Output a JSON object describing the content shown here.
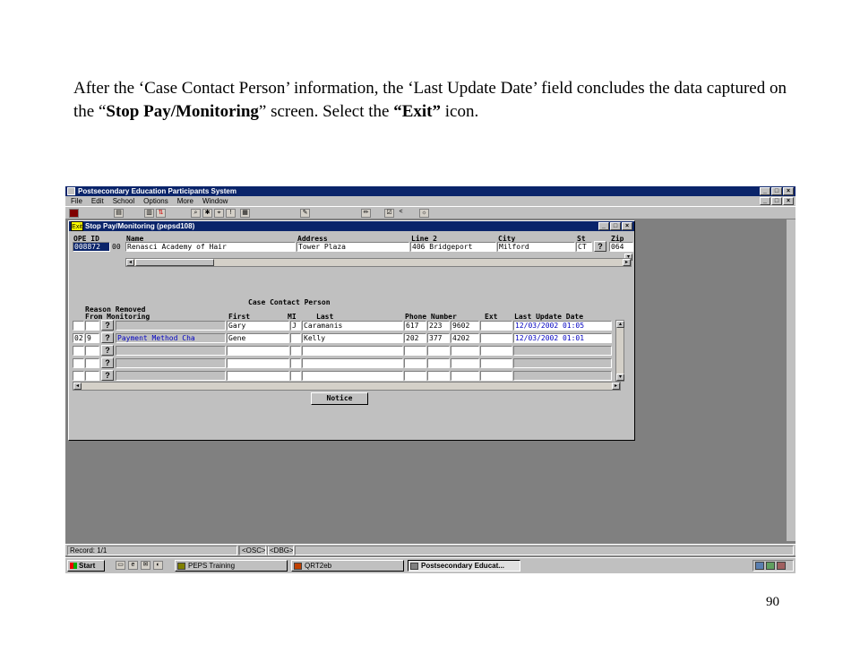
{
  "caption": {
    "p1": "After the ‘Case Contact Person’ information, the ‘Last Update Date’ field concludes the data captured on the “",
    "b1": "Stop Pay/Monitoring",
    "p2": "” screen.  Select the ",
    "b2": "“Exit”",
    "p3": " icon."
  },
  "slide_number": "90",
  "app": {
    "title": "Postsecondary Education Participants System",
    "menu": [
      "File",
      "Edit",
      "School",
      "Options",
      "More",
      "Window"
    ]
  },
  "child": {
    "title": "Stop Pay/Monitoring (pepsd108)",
    "exit_label": "Exit",
    "header": {
      "labels": {
        "ope_id": "OPE ID",
        "name": "Name",
        "address": "Address",
        "line2": "Line 2",
        "city": "City",
        "st": "St",
        "zip": "Zip"
      },
      "values": {
        "ope_id": "008872",
        "ope_suffix": "00",
        "name": "Renasci Academy of Hair",
        "address": "Tower Plaza",
        "line2": "406 Bridgeport",
        "city": "Milford",
        "st": "CT",
        "zip": "064"
      }
    },
    "grid": {
      "headers": {
        "reason_removed": "Reason Removed",
        "from_monitoring": "From Monitoring",
        "case_contact": "Case Contact Person",
        "first": "First",
        "mi": "MI",
        "last": "Last",
        "phone": "Phone Number",
        "ext": "Ext",
        "last_update": "Last Update Date"
      },
      "rows": [
        {
          "code1": "",
          "code2": "",
          "reason": "",
          "first": "Gary",
          "mi": "J",
          "last": "Caramanis",
          "ph1": "617",
          "ph2": "223",
          "ph3": "9602",
          "ext": "",
          "date": "12/03/2002 01:05"
        },
        {
          "code1": "02",
          "code2": "9",
          "reason": "Payment Method Cha",
          "first": "Gene",
          "mi": "",
          "last": "Kelly",
          "ph1": "202",
          "ph2": "377",
          "ph3": "4202",
          "ext": "",
          "date": "12/03/2002 01:01"
        },
        {
          "code1": "",
          "code2": "",
          "reason": "",
          "first": "",
          "mi": "",
          "last": "",
          "ph1": "",
          "ph2": "",
          "ph3": "",
          "ext": "",
          "date": ""
        },
        {
          "code1": "",
          "code2": "",
          "reason": "",
          "first": "",
          "mi": "",
          "last": "",
          "ph1": "",
          "ph2": "",
          "ph3": "",
          "ext": "",
          "date": ""
        },
        {
          "code1": "",
          "code2": "",
          "reason": "",
          "first": "",
          "mi": "",
          "last": "",
          "ph1": "",
          "ph2": "",
          "ph3": "",
          "ext": "",
          "date": ""
        }
      ]
    },
    "notice_label": "Notice"
  },
  "statusbar": {
    "record": "Record: 1/1",
    "osc": "<OSC>",
    "dbg": "<DBG>"
  },
  "taskbar": {
    "start": "Start",
    "tasks": [
      "PEPS Training",
      "QRT2eb",
      "Postsecondary Educat..."
    ]
  }
}
